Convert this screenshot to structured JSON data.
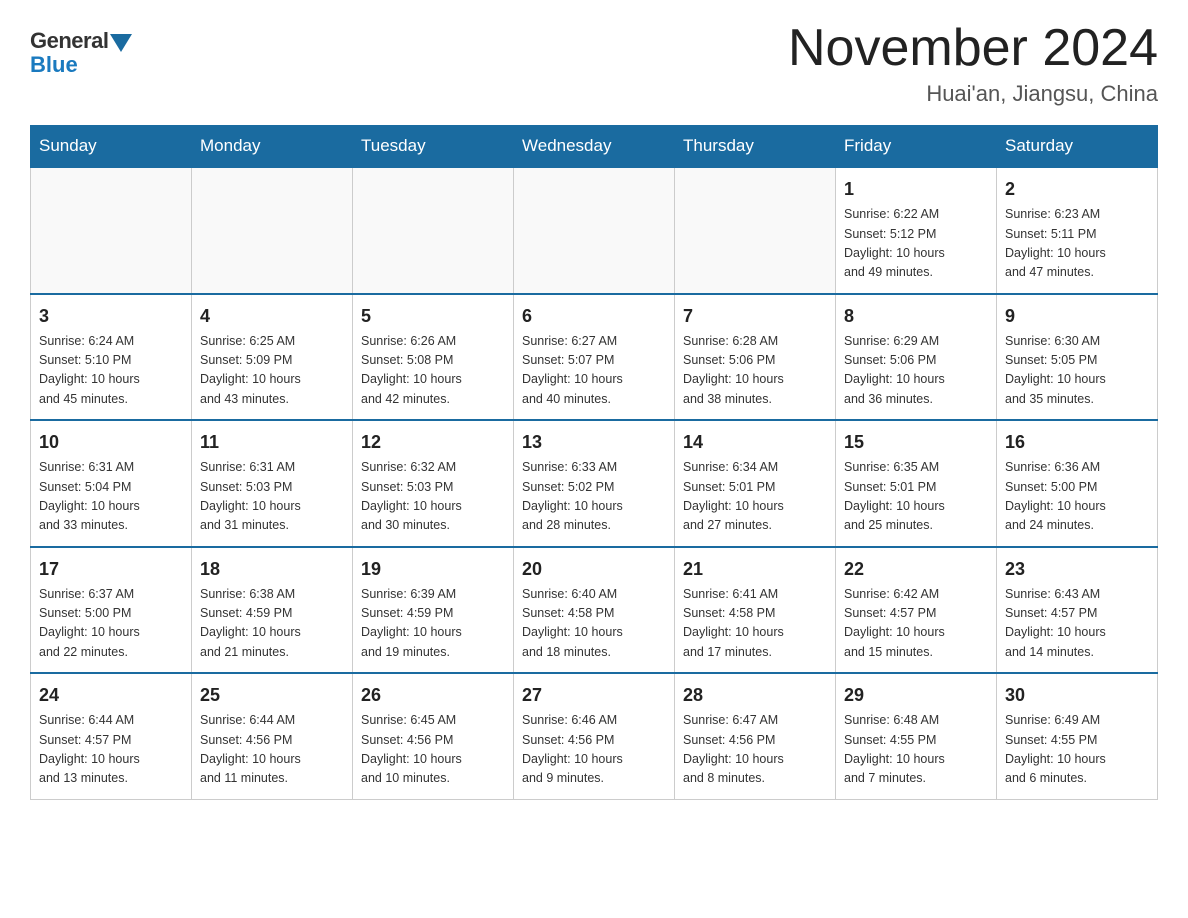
{
  "header": {
    "logo_general": "General",
    "logo_blue": "Blue",
    "title": "November 2024",
    "subtitle": "Huai'an, Jiangsu, China"
  },
  "weekdays": [
    "Sunday",
    "Monday",
    "Tuesday",
    "Wednesday",
    "Thursday",
    "Friday",
    "Saturday"
  ],
  "weeks": [
    [
      {
        "day": "",
        "info": ""
      },
      {
        "day": "",
        "info": ""
      },
      {
        "day": "",
        "info": ""
      },
      {
        "day": "",
        "info": ""
      },
      {
        "day": "",
        "info": ""
      },
      {
        "day": "1",
        "info": "Sunrise: 6:22 AM\nSunset: 5:12 PM\nDaylight: 10 hours\nand 49 minutes."
      },
      {
        "day": "2",
        "info": "Sunrise: 6:23 AM\nSunset: 5:11 PM\nDaylight: 10 hours\nand 47 minutes."
      }
    ],
    [
      {
        "day": "3",
        "info": "Sunrise: 6:24 AM\nSunset: 5:10 PM\nDaylight: 10 hours\nand 45 minutes."
      },
      {
        "day": "4",
        "info": "Sunrise: 6:25 AM\nSunset: 5:09 PM\nDaylight: 10 hours\nand 43 minutes."
      },
      {
        "day": "5",
        "info": "Sunrise: 6:26 AM\nSunset: 5:08 PM\nDaylight: 10 hours\nand 42 minutes."
      },
      {
        "day": "6",
        "info": "Sunrise: 6:27 AM\nSunset: 5:07 PM\nDaylight: 10 hours\nand 40 minutes."
      },
      {
        "day": "7",
        "info": "Sunrise: 6:28 AM\nSunset: 5:06 PM\nDaylight: 10 hours\nand 38 minutes."
      },
      {
        "day": "8",
        "info": "Sunrise: 6:29 AM\nSunset: 5:06 PM\nDaylight: 10 hours\nand 36 minutes."
      },
      {
        "day": "9",
        "info": "Sunrise: 6:30 AM\nSunset: 5:05 PM\nDaylight: 10 hours\nand 35 minutes."
      }
    ],
    [
      {
        "day": "10",
        "info": "Sunrise: 6:31 AM\nSunset: 5:04 PM\nDaylight: 10 hours\nand 33 minutes."
      },
      {
        "day": "11",
        "info": "Sunrise: 6:31 AM\nSunset: 5:03 PM\nDaylight: 10 hours\nand 31 minutes."
      },
      {
        "day": "12",
        "info": "Sunrise: 6:32 AM\nSunset: 5:03 PM\nDaylight: 10 hours\nand 30 minutes."
      },
      {
        "day": "13",
        "info": "Sunrise: 6:33 AM\nSunset: 5:02 PM\nDaylight: 10 hours\nand 28 minutes."
      },
      {
        "day": "14",
        "info": "Sunrise: 6:34 AM\nSunset: 5:01 PM\nDaylight: 10 hours\nand 27 minutes."
      },
      {
        "day": "15",
        "info": "Sunrise: 6:35 AM\nSunset: 5:01 PM\nDaylight: 10 hours\nand 25 minutes."
      },
      {
        "day": "16",
        "info": "Sunrise: 6:36 AM\nSunset: 5:00 PM\nDaylight: 10 hours\nand 24 minutes."
      }
    ],
    [
      {
        "day": "17",
        "info": "Sunrise: 6:37 AM\nSunset: 5:00 PM\nDaylight: 10 hours\nand 22 minutes."
      },
      {
        "day": "18",
        "info": "Sunrise: 6:38 AM\nSunset: 4:59 PM\nDaylight: 10 hours\nand 21 minutes."
      },
      {
        "day": "19",
        "info": "Sunrise: 6:39 AM\nSunset: 4:59 PM\nDaylight: 10 hours\nand 19 minutes."
      },
      {
        "day": "20",
        "info": "Sunrise: 6:40 AM\nSunset: 4:58 PM\nDaylight: 10 hours\nand 18 minutes."
      },
      {
        "day": "21",
        "info": "Sunrise: 6:41 AM\nSunset: 4:58 PM\nDaylight: 10 hours\nand 17 minutes."
      },
      {
        "day": "22",
        "info": "Sunrise: 6:42 AM\nSunset: 4:57 PM\nDaylight: 10 hours\nand 15 minutes."
      },
      {
        "day": "23",
        "info": "Sunrise: 6:43 AM\nSunset: 4:57 PM\nDaylight: 10 hours\nand 14 minutes."
      }
    ],
    [
      {
        "day": "24",
        "info": "Sunrise: 6:44 AM\nSunset: 4:57 PM\nDaylight: 10 hours\nand 13 minutes."
      },
      {
        "day": "25",
        "info": "Sunrise: 6:44 AM\nSunset: 4:56 PM\nDaylight: 10 hours\nand 11 minutes."
      },
      {
        "day": "26",
        "info": "Sunrise: 6:45 AM\nSunset: 4:56 PM\nDaylight: 10 hours\nand 10 minutes."
      },
      {
        "day": "27",
        "info": "Sunrise: 6:46 AM\nSunset: 4:56 PM\nDaylight: 10 hours\nand 9 minutes."
      },
      {
        "day": "28",
        "info": "Sunrise: 6:47 AM\nSunset: 4:56 PM\nDaylight: 10 hours\nand 8 minutes."
      },
      {
        "day": "29",
        "info": "Sunrise: 6:48 AM\nSunset: 4:55 PM\nDaylight: 10 hours\nand 7 minutes."
      },
      {
        "day": "30",
        "info": "Sunrise: 6:49 AM\nSunset: 4:55 PM\nDaylight: 10 hours\nand 6 minutes."
      }
    ]
  ]
}
